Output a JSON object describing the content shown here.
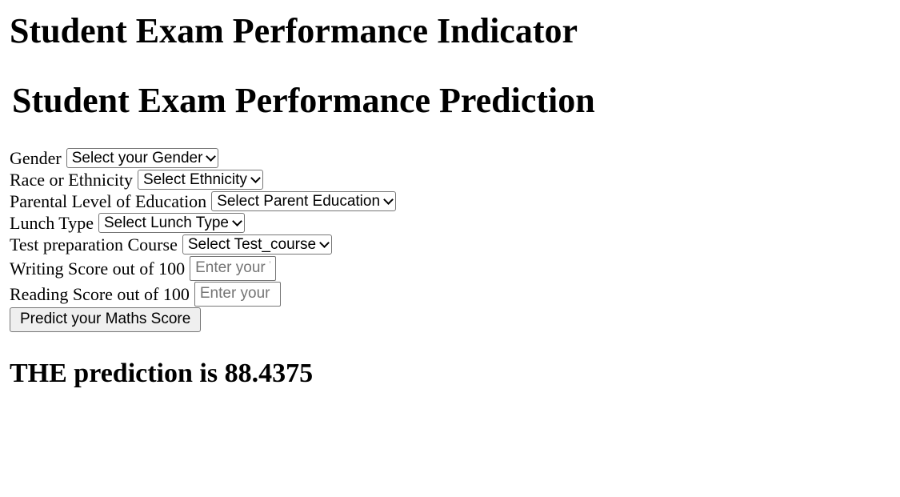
{
  "page": {
    "title": "Student Exam Performance Indicator",
    "subtitle": "Student Exam Performance Prediction"
  },
  "form": {
    "gender": {
      "label": "Gender",
      "selected": "Select your Gender"
    },
    "ethnicity": {
      "label": "Race or Ethnicity",
      "selected": "Select Ethnicity"
    },
    "parental_education": {
      "label": "Parental Level of Education",
      "selected": "Select Parent Education"
    },
    "lunch": {
      "label": "Lunch Type",
      "selected": "Select Lunch Type"
    },
    "test_course": {
      "label": "Test preparation Course",
      "selected": "Select Test_course"
    },
    "writing_score": {
      "label": "Writing Score out of 100",
      "placeholder": "Enter your Writing score"
    },
    "reading_score": {
      "label": "Reading Score out of 100",
      "placeholder": "Enter your Reading Score"
    },
    "submit_label": "Predict your Maths Score"
  },
  "result": {
    "text": "THE prediction is 88.4375"
  }
}
